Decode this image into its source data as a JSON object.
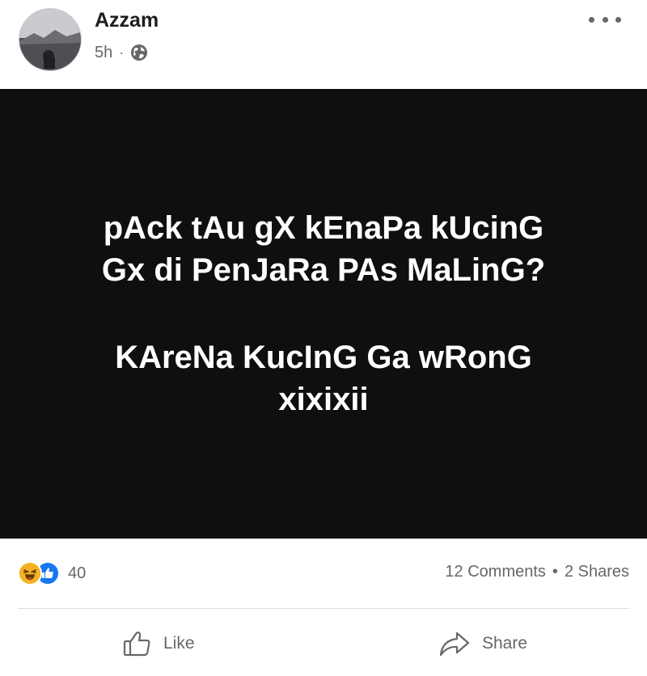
{
  "post": {
    "author": "Azzam",
    "time": "5h",
    "separator": "·",
    "privacy_icon": "globe-icon",
    "more_icon": "more-options-icon"
  },
  "image_text": {
    "line1": "pAck tAu gX kEnaPa kUcinG",
    "line2": "Gx di PenJaRa PAs MaLinG?",
    "line3": "KAreNa KucInG Ga wRonG",
    "line4": "xixixii"
  },
  "stats": {
    "reaction_icons": [
      "haha-icon",
      "like-icon"
    ],
    "reaction_count": "40",
    "comments": "12 Comments",
    "dot": "•",
    "shares": "2 Shares"
  },
  "actions": {
    "like_label": "Like",
    "share_label": "Share"
  },
  "colors": {
    "text_primary": "#1c1e21",
    "text_secondary": "#65676b",
    "image_bg": "#0f0f0f",
    "like_blue": "#1877f2",
    "haha_yellow": "#f7b125",
    "divider": "#dadde1"
  }
}
